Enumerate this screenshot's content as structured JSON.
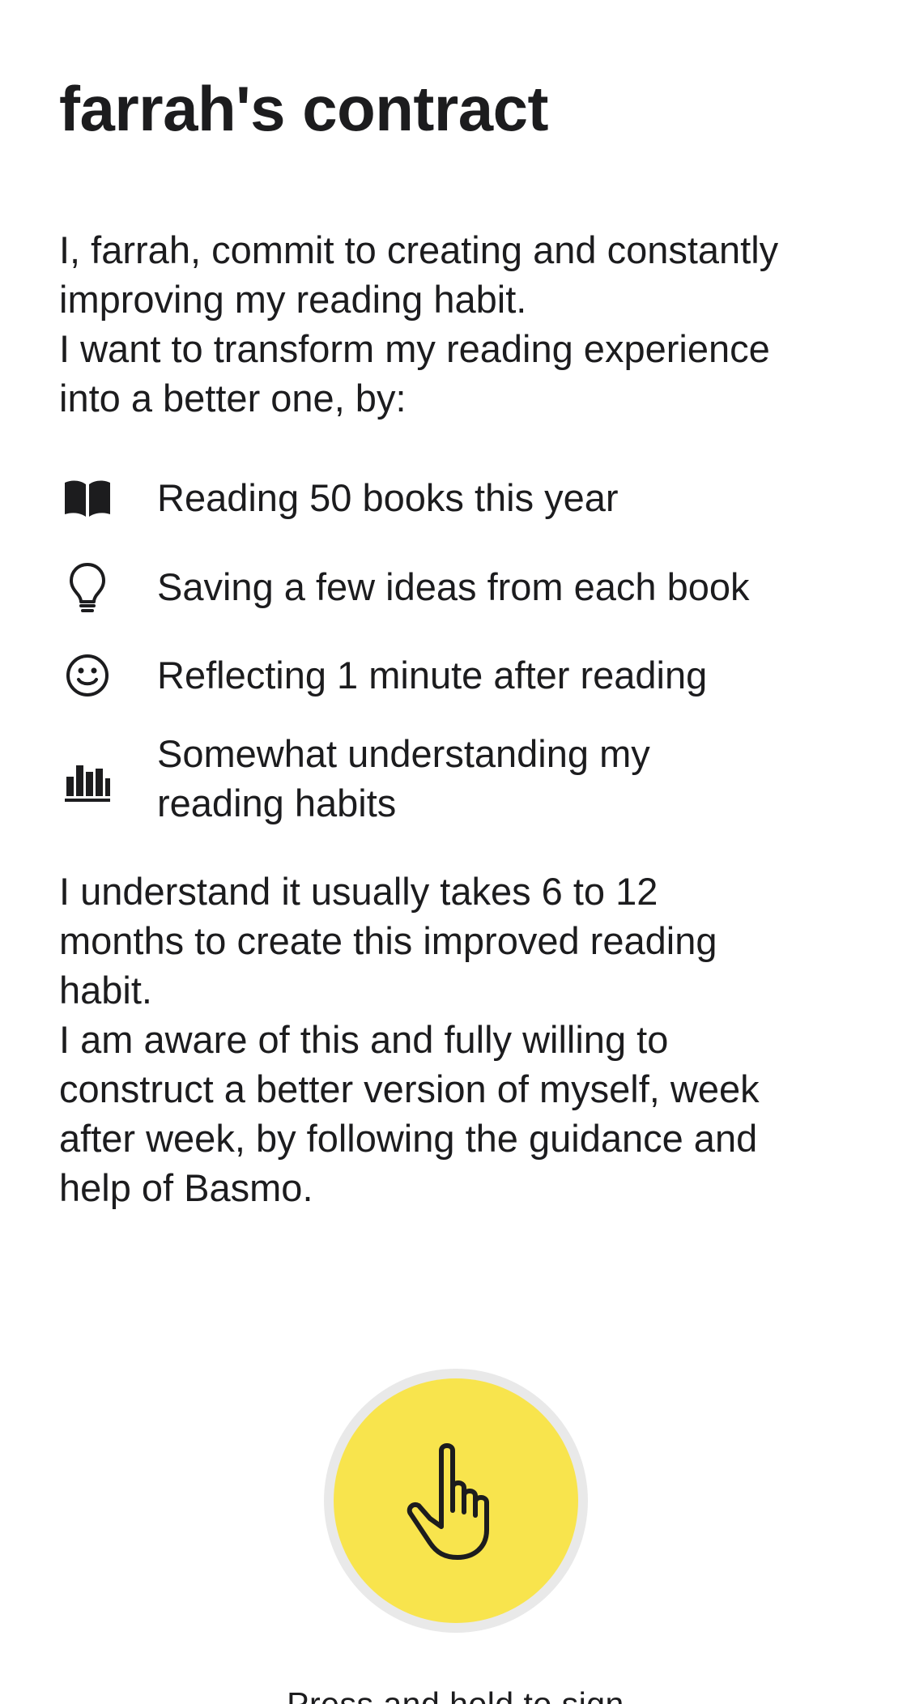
{
  "contract": {
    "title": "farrah's contract",
    "intro": [
      "I, farrah, commit to creating and constantly",
      "improving my reading habit.",
      "I want to transform my reading experience",
      "into a better one, by:"
    ],
    "commitments": [
      {
        "icon": "open-book-icon",
        "lines": [
          "Reading 50 books this year"
        ]
      },
      {
        "icon": "lightbulb-icon",
        "lines": [
          "Saving a few ideas from each book"
        ]
      },
      {
        "icon": "smiley-face-icon",
        "lines": [
          "Reflecting 1 minute after reading"
        ]
      },
      {
        "icon": "bar-chart-icon",
        "lines": [
          "Somewhat understanding my",
          "reading habits"
        ]
      }
    ],
    "outro": [
      "I understand it usually takes 6 to 12",
      "months to create this improved reading",
      "habit.",
      "I am aware of this and fully willing to",
      "construct a better version of myself, week",
      "after week, by following the guidance and",
      "help of Basmo."
    ]
  },
  "sign": {
    "icon": "hand-pointer-icon",
    "caption": "Press and hold to sign",
    "button_color": "#f8e44d",
    "ring_color": "#e9e9e9"
  }
}
